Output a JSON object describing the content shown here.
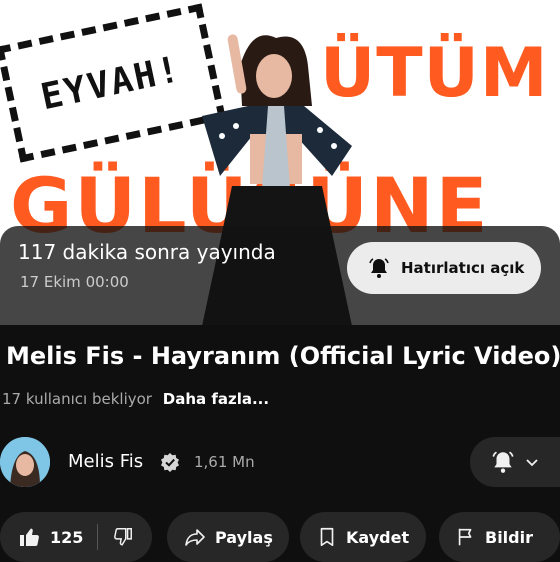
{
  "thumbnail": {
    "sticker_text": "EYVAH!",
    "word_top": "ÜTÜM",
    "word_bottom": "GÜLÜŞÜNE"
  },
  "live": {
    "countdown": "117 dakika sonra yayında",
    "date": "17 Ekim 00:00",
    "reminder_label": "Hatırlatıcı açık"
  },
  "video": {
    "title": "Melis Fis - Hayranım (Official Lyric Video)",
    "waiting": "17 kullanıcı bekliyor",
    "more_label": "Daha fazla..."
  },
  "channel": {
    "name": "Melis Fis",
    "subscribers": "1,61 Mn"
  },
  "actions": {
    "like_count": "125",
    "share_label": "Paylaş",
    "save_label": "Kaydet",
    "report_label": "Bildir"
  },
  "colors": {
    "background": "#0f0f0f",
    "pill": "#272727",
    "accent_orange": "#ff5a1f"
  }
}
